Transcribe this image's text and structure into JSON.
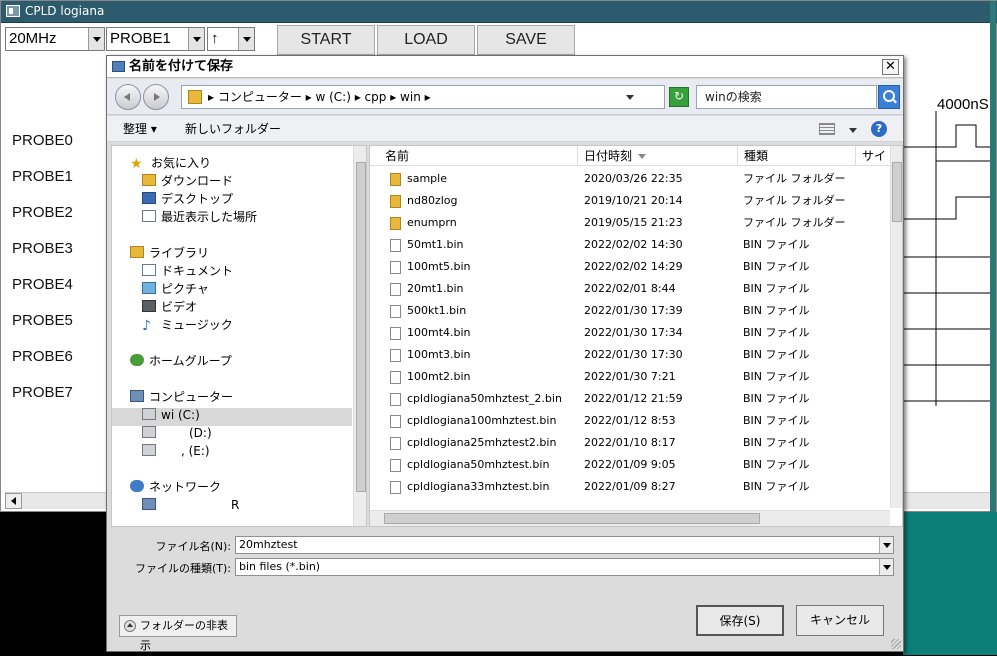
{
  "app": {
    "title": "CPLD logiana",
    "clock": "20MHz",
    "probe_select": "PROBE1",
    "edge_select": "↑",
    "buttons": {
      "start": "START",
      "load": "LOAD",
      "save": "SAVE"
    },
    "probes": [
      "PROBE0",
      "PROBE1",
      "PROBE2",
      "PROBE3",
      "PROBE4",
      "PROBE5",
      "PROBE6",
      "PROBE7"
    ],
    "time_label": "4000nS"
  },
  "dialog": {
    "title": "名前を付けて保存",
    "close": "✕",
    "address_path": "▸ コンピューター ▸ w        (C:) ▸ cpp ▸ win ▸",
    "search_placeholder": "winの検索",
    "toolbar": {
      "organize": "整理 ▾",
      "new_folder": "新しいフォルダー",
      "help": "?"
    },
    "nav": {
      "favorites": "お気に入り",
      "downloads": "ダウンロード",
      "desktop": "デスクトップ",
      "recent": "最近表示した場所",
      "libraries": "ライブラリ",
      "documents": "ドキュメント",
      "pictures": "ピクチャ",
      "videos": "ビデオ",
      "music": "ミュージック",
      "homegroup": "ホームグループ",
      "computer": "コンピューター",
      "drive_c": "wi    (C:)",
      "drive_d": "(D:)",
      "drive_e": ", (E:)",
      "network": "ネットワーク",
      "net_item": "R"
    },
    "columns": {
      "name": "名前",
      "date": "日付時刻",
      "type": "種類",
      "size": "サイ"
    },
    "files": [
      {
        "name": "sample",
        "date": "2020/03/26 22:35",
        "type": "ファイル フォルダー",
        "kind": "folder"
      },
      {
        "name": "nd80zlog",
        "date": "2019/10/21 20:14",
        "type": "ファイル フォルダー",
        "kind": "folder"
      },
      {
        "name": "enumprn",
        "date": "2019/05/15 21:23",
        "type": "ファイル フォルダー",
        "kind": "folder"
      },
      {
        "name": "50mt1.bin",
        "date": "2022/02/02 14:30",
        "type": "BIN ファイル",
        "kind": "file"
      },
      {
        "name": "100mt5.bin",
        "date": "2022/02/02 14:29",
        "type": "BIN ファイル",
        "kind": "file"
      },
      {
        "name": "20mt1.bin",
        "date": "2022/02/01 8:44",
        "type": "BIN ファイル",
        "kind": "file"
      },
      {
        "name": "500kt1.bin",
        "date": "2022/01/30 17:39",
        "type": "BIN ファイル",
        "kind": "file"
      },
      {
        "name": "100mt4.bin",
        "date": "2022/01/30 17:34",
        "type": "BIN ファイル",
        "kind": "file"
      },
      {
        "name": "100mt3.bin",
        "date": "2022/01/30 17:30",
        "type": "BIN ファイル",
        "kind": "file"
      },
      {
        "name": "100mt2.bin",
        "date": "2022/01/30 7:21",
        "type": "BIN ファイル",
        "kind": "file"
      },
      {
        "name": "cpldlogiana50mhztest_2.bin",
        "date": "2022/01/12 21:59",
        "type": "BIN ファイル",
        "kind": "file"
      },
      {
        "name": "cpldlogiana100mhztest.bin",
        "date": "2022/01/12 8:53",
        "type": "BIN ファイル",
        "kind": "file"
      },
      {
        "name": "cpldlogiana25mhztest2.bin",
        "date": "2022/01/10 8:17",
        "type": "BIN ファイル",
        "kind": "file"
      },
      {
        "name": "cpldlogiana50mhztest.bin",
        "date": "2022/01/09 9:05",
        "type": "BIN ファイル",
        "kind": "file"
      },
      {
        "name": "cpldlogiana33mhztest.bin",
        "date": "2022/01/09 8:27",
        "type": "BIN ファイル",
        "kind": "file"
      }
    ],
    "filename_label": "ファイル名(N):",
    "filename_value": "20mhztest",
    "filetype_label": "ファイルの種類(T):",
    "filetype_value": "bin files (*.bin)",
    "hide_folders": "フォルダーの非表示",
    "save_button": "保存(S)",
    "cancel_button": "キャンセル"
  }
}
